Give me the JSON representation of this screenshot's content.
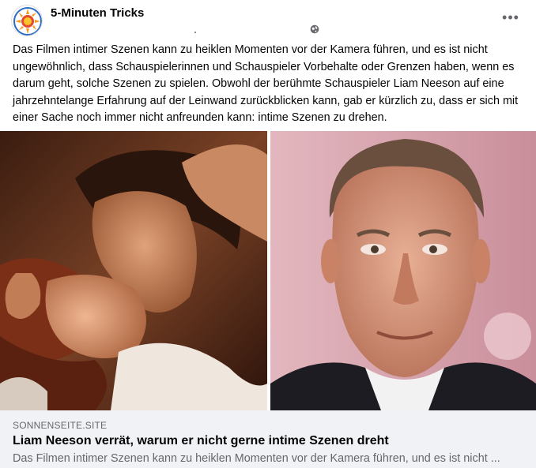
{
  "header": {
    "page_name": "5-Minuten Tricks",
    "more_label": "•••",
    "avatar_icon": "sun-logo-icon",
    "privacy_icon": "globe-icon"
  },
  "post": {
    "text": "Das Filmen intimer Szenen kann zu heiklen Momenten vor der Kamera führen, und es ist nicht ungewöhnlich, dass Schauspielerinnen und Schauspieler Vorbehalte oder Grenzen haben, wenn es darum geht, solche Szenen zu spielen. Obwohl der berühmte Schauspieler Liam Neeson auf eine jahrzehntelange Erfahrung auf der Leinwand zurückblicken kann, gab er kürzlich zu, dass er sich mit einer Sache noch immer nicht anfreunden kann: intime Szenen zu drehen."
  },
  "preview": {
    "domain": "SONNENSEITE.SITE",
    "title": "Liam Neeson verrät, warum er nicht gerne intime Szenen dreht",
    "description": "Das Filmen intimer Szenen kann zu heiklen Momenten vor der Kamera führen, und es ist nicht ..."
  },
  "colors": {
    "text_primary": "#050505",
    "text_secondary": "#65676b",
    "preview_bg": "#f0f2f5",
    "logo_orange": "#f39a1d",
    "logo_blue": "#2b6cc4"
  }
}
